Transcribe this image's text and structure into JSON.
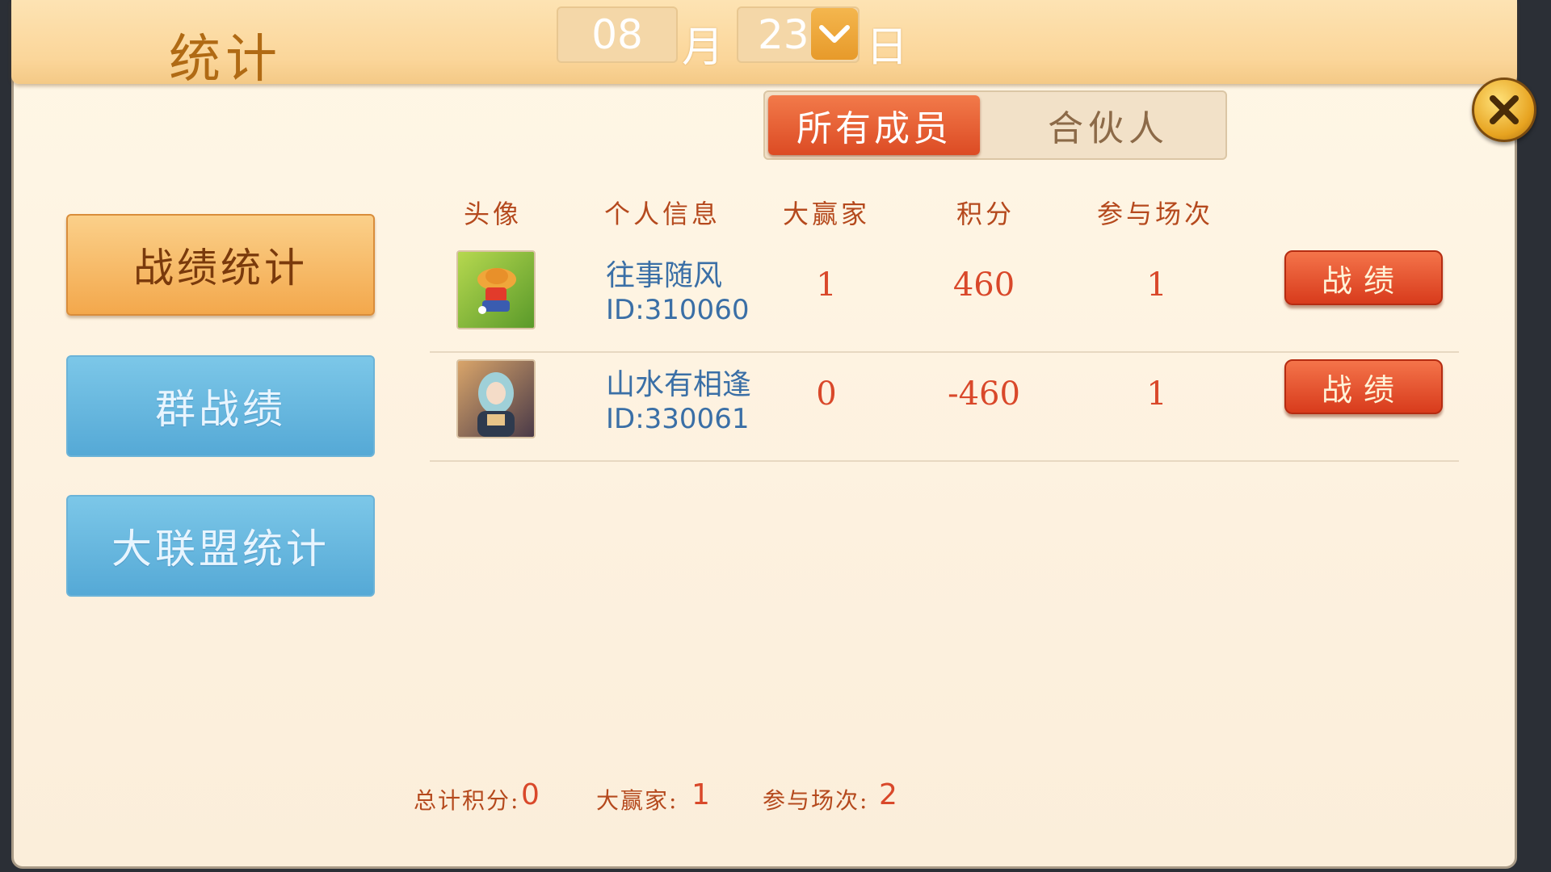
{
  "header": {
    "title": "统计",
    "month": "08",
    "month_unit": "月",
    "day": "23",
    "day_unit": "日"
  },
  "tabs": [
    {
      "label": "所有成员",
      "active": true
    },
    {
      "label": "合伙人",
      "active": false
    }
  ],
  "nav": [
    {
      "label": "战绩统计",
      "active": true
    },
    {
      "label": "群战绩",
      "active": false
    },
    {
      "label": "大联盟统计",
      "active": false
    }
  ],
  "table": {
    "headers": [
      "头像",
      "个人信息",
      "大赢家",
      "积分",
      "参与场次"
    ],
    "rows": [
      {
        "name": "往事随风",
        "id": "ID:310060",
        "big_winner": "1",
        "score": "460",
        "games": "1",
        "button": "战绩"
      },
      {
        "name": "山水有相逢",
        "id": "ID:330061",
        "big_winner": "0",
        "score": "-460",
        "games": "1",
        "button": "战绩"
      }
    ]
  },
  "summary": {
    "total_score_label": "总计积分:",
    "total_score": "0",
    "big_winner_label": "大赢家:",
    "big_winner": "1",
    "games_label": "参与场次:",
    "games": "2"
  },
  "colors": {
    "accent": "#d9482a",
    "nav_active": "#f3a84c",
    "nav_idle": "#55a9d6"
  }
}
